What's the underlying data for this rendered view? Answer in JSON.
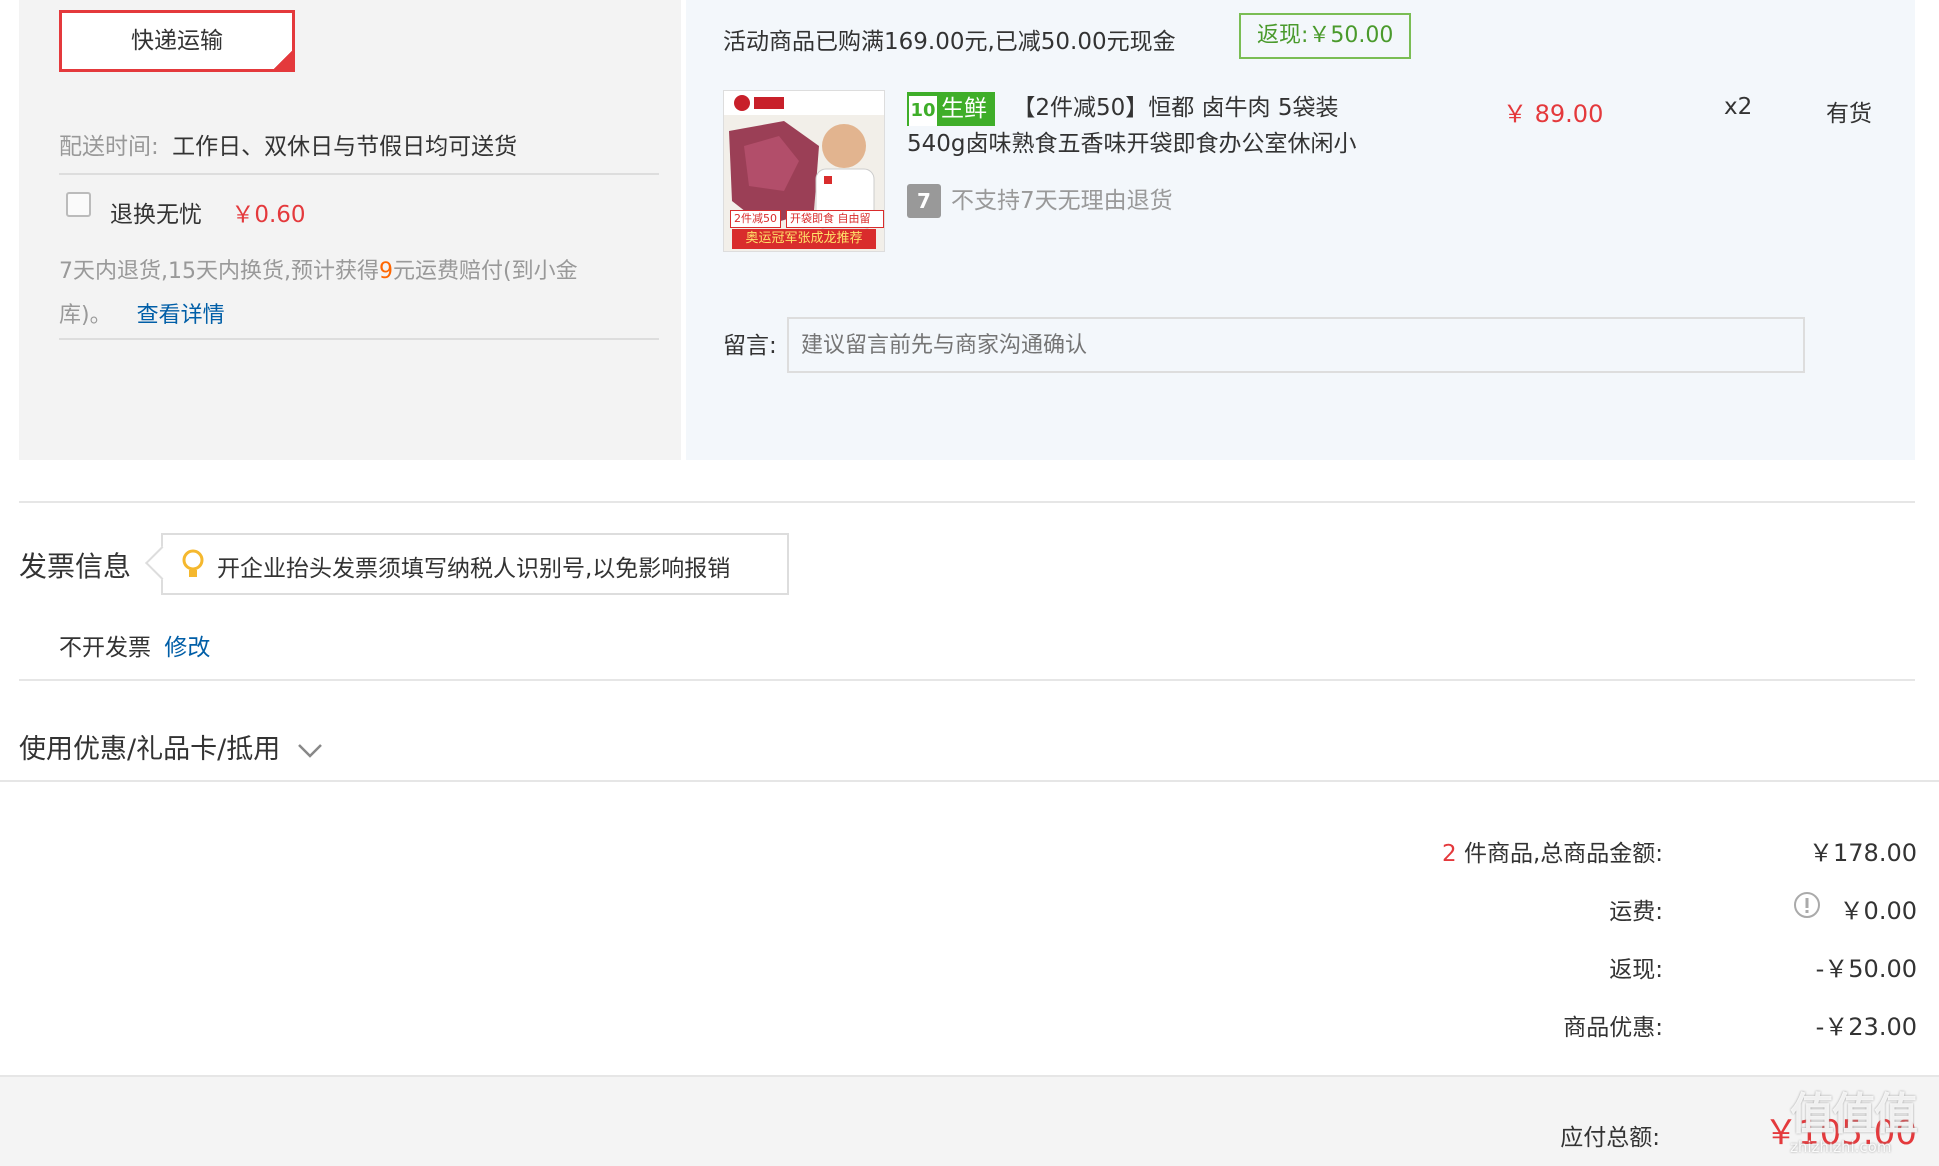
{
  "shipping": {
    "option_label": "快递运输",
    "delivery_time_label": "配送时间:",
    "delivery_time_value": "工作日、双休日与节假日均可送货",
    "return_service": {
      "label": "退换无忧",
      "price": "￥0.60",
      "checked": false,
      "desc_before": "7天内退货,15天内换货,预计获得",
      "desc_highlight": "9",
      "desc_after_line1": "元运费赔付(到小金",
      "desc_line2": "库)。",
      "details_link": "查看详情"
    }
  },
  "promo": {
    "text": "活动商品已购满169.00元,已减50.00元现金",
    "cashback_badge": "返现:￥50.00"
  },
  "product": {
    "tag": "生鲜",
    "title_line1": "【2件减50】恒都 卤牛肉 5袋装",
    "title_line2": "540g卤味熟食五香味开袋即食办公室休闲小",
    "price": "￥ 89.00",
    "quantity": "x2",
    "stock": "有货",
    "return_policy": "不支持7天无理由退货",
    "image_badges": [
      "2件减50",
      "开袋即食 自由留香"
    ],
    "image_banner": "奥运冠军张成龙推荐"
  },
  "message": {
    "label": "留言:",
    "placeholder": "建议留言前先与商家沟通确认"
  },
  "invoice": {
    "title": "发票信息",
    "tip": "开企业抬头发票须填写纳税人识别号,以免影响报销",
    "status": "不开发票",
    "edit_link": "修改"
  },
  "coupon": {
    "label": "使用优惠/礼品卡/抵用"
  },
  "summary": {
    "count": "2",
    "items_label": "件商品,总商品金额:",
    "items_value": "￥178.00",
    "shipping_label": "运费:",
    "shipping_value": "￥0.00",
    "cashback_label": "返现:",
    "cashback_value": "-￥50.00",
    "discount_label": "商品优惠:",
    "discount_value": "-￥23.00",
    "total_label": "应付总额:",
    "total_value": "￥105.00"
  },
  "watermark": {
    "text": "值值值",
    "sub": "zhizhizhi.com"
  },
  "colors": {
    "accent_red": "#e4393c",
    "link_blue": "#005ea7",
    "orange": "#ff6600",
    "fresh_green": "#3fae29"
  }
}
